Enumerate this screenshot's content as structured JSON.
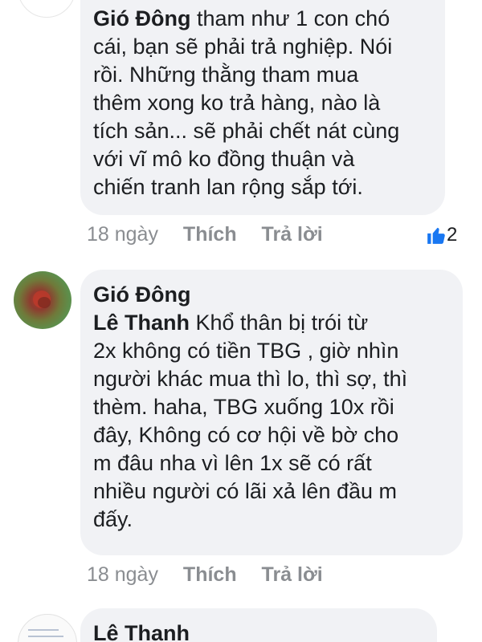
{
  "comments": [
    {
      "author": "Gió Đông",
      "text_lines": [
        " tham như 1 con chó",
        "cái, bạn sẽ phải trả nghiệp. Nói",
        "rồi. Những thằng tham mua",
        "thêm xong ko trả hàng, nào là",
        "tích sản... sẽ phải chết nát cùng",
        "với vĩ mô ko đồng thuận và",
        "chiến tranh lan rộng sắp tới."
      ],
      "time": "18 ngày",
      "like_label": "Thích",
      "reply_label": "Trả lời",
      "reaction_count": "2",
      "reaction_icon": "like-icon",
      "reaction_color": "#1877f2"
    },
    {
      "author": "Gió Đông",
      "mention": "Lê Thanh",
      "text_lines": [
        " Khổ thân bị trói từ",
        "2x không có tiền TBG , giờ nhìn",
        "người khác mua thì lo, thì sợ, thì",
        "thèm. haha, TBG xuống 10x rồi",
        "đây, Không có cơ hội về bờ cho",
        "m đâu nha vì lên 1x sẽ có rất",
        "nhiều người có lãi xả lên đầu m",
        "đấy."
      ],
      "time": "18 ngày",
      "like_label": "Thích",
      "reply_label": "Trả lời"
    },
    {
      "author": "Lê Thanh"
    }
  ]
}
